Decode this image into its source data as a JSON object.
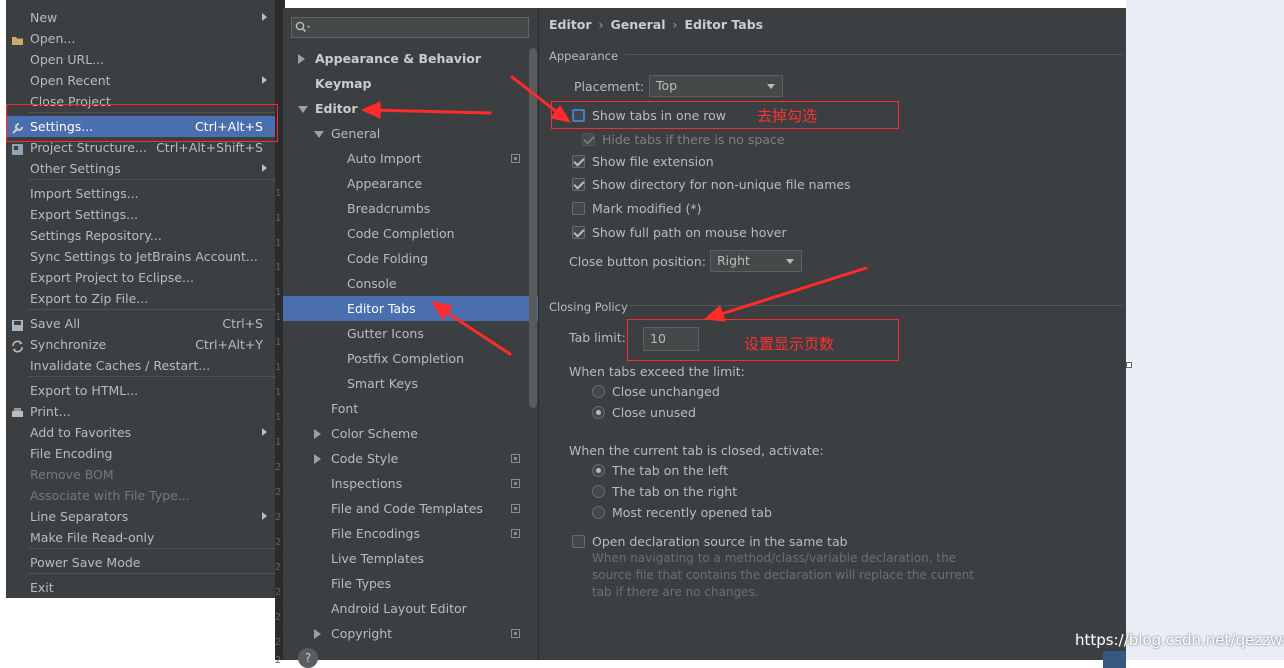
{
  "file_menu": {
    "items": [
      {
        "label": "New",
        "shortcut": "",
        "submenu": true,
        "icon": ""
      },
      {
        "label": "Open...",
        "shortcut": "",
        "submenu": false,
        "icon": "folder-icon"
      },
      {
        "label": "Open URL...",
        "shortcut": "",
        "submenu": false,
        "icon": ""
      },
      {
        "label": "Open Recent",
        "shortcut": "",
        "submenu": true,
        "icon": ""
      },
      {
        "label": "Close Project",
        "shortcut": "",
        "submenu": false,
        "icon": ""
      },
      {
        "label": "Settings...",
        "shortcut": "Ctrl+Alt+S",
        "submenu": false,
        "icon": "wrench-icon",
        "selected": true
      },
      {
        "label": "Project Structure...",
        "shortcut": "Ctrl+Alt+Shift+S",
        "submenu": false,
        "icon": "project-structure-icon"
      },
      {
        "label": "Other Settings",
        "shortcut": "",
        "submenu": true,
        "icon": ""
      },
      {
        "label": "Import Settings...",
        "shortcut": "",
        "submenu": false,
        "icon": ""
      },
      {
        "label": "Export Settings...",
        "shortcut": "",
        "submenu": false,
        "icon": ""
      },
      {
        "label": "Settings Repository...",
        "shortcut": "",
        "submenu": false,
        "icon": ""
      },
      {
        "label": "Sync Settings to JetBrains Account...",
        "shortcut": "",
        "submenu": false,
        "icon": ""
      },
      {
        "label": "Export Project to Eclipse...",
        "shortcut": "",
        "submenu": false,
        "icon": ""
      },
      {
        "label": "Export to Zip File...",
        "shortcut": "",
        "submenu": false,
        "icon": ""
      },
      {
        "label": "Save All",
        "shortcut": "Ctrl+S",
        "submenu": false,
        "icon": "save-icon"
      },
      {
        "label": "Synchronize",
        "shortcut": "Ctrl+Alt+Y",
        "submenu": false,
        "icon": "sync-icon"
      },
      {
        "label": "Invalidate Caches / Restart...",
        "shortcut": "",
        "submenu": false,
        "icon": ""
      },
      {
        "label": "Export to HTML...",
        "shortcut": "",
        "submenu": false,
        "icon": ""
      },
      {
        "label": "Print...",
        "shortcut": "",
        "submenu": false,
        "icon": "print-icon"
      },
      {
        "label": "Add to Favorites",
        "shortcut": "",
        "submenu": true,
        "icon": ""
      },
      {
        "label": "File Encoding",
        "shortcut": "",
        "submenu": false,
        "icon": ""
      },
      {
        "label": "Remove BOM",
        "shortcut": "",
        "submenu": false,
        "icon": "",
        "disabled": true
      },
      {
        "label": "Associate with File Type...",
        "shortcut": "",
        "submenu": false,
        "icon": "",
        "disabled": true
      },
      {
        "label": "Line Separators",
        "shortcut": "",
        "submenu": true,
        "icon": ""
      },
      {
        "label": "Make File Read-only",
        "shortcut": "",
        "submenu": false,
        "icon": ""
      },
      {
        "label": "Power Save Mode",
        "shortcut": "",
        "submenu": false,
        "icon": ""
      },
      {
        "label": "Exit",
        "shortcut": "",
        "submenu": false,
        "icon": ""
      }
    ]
  },
  "gutter_numbers": [
    "1",
    "1",
    "1",
    "1",
    "1",
    "1",
    "1",
    "1",
    "1",
    "1",
    "1",
    "2",
    "2",
    "2",
    "2",
    "2",
    "2",
    "2",
    "2",
    "2"
  ],
  "settings": {
    "search_placeholder": "",
    "tree": [
      {
        "label": "Appearance & Behavior",
        "level": 0,
        "bold": true,
        "expander": "right"
      },
      {
        "label": "Keymap",
        "level": 0,
        "bold": true,
        "expander": ""
      },
      {
        "label": "Editor",
        "level": 0,
        "bold": true,
        "expander": "down"
      },
      {
        "label": "General",
        "level": 1,
        "bold": false,
        "expander": "down"
      },
      {
        "label": "Auto Import",
        "level": 2,
        "bold": false,
        "expander": "",
        "copy_icon": true
      },
      {
        "label": "Appearance",
        "level": 2,
        "bold": false,
        "expander": ""
      },
      {
        "label": "Breadcrumbs",
        "level": 2,
        "bold": false,
        "expander": ""
      },
      {
        "label": "Code Completion",
        "level": 2,
        "bold": false,
        "expander": ""
      },
      {
        "label": "Code Folding",
        "level": 2,
        "bold": false,
        "expander": ""
      },
      {
        "label": "Console",
        "level": 2,
        "bold": false,
        "expander": ""
      },
      {
        "label": "Editor Tabs",
        "level": 2,
        "bold": false,
        "expander": "",
        "selected": true
      },
      {
        "label": "Gutter Icons",
        "level": 2,
        "bold": false,
        "expander": ""
      },
      {
        "label": "Postfix Completion",
        "level": 2,
        "bold": false,
        "expander": ""
      },
      {
        "label": "Smart Keys",
        "level": 2,
        "bold": false,
        "expander": ""
      },
      {
        "label": "Font",
        "level": 1,
        "bold": false,
        "expander": ""
      },
      {
        "label": "Color Scheme",
        "level": 1,
        "bold": false,
        "expander": "right"
      },
      {
        "label": "Code Style",
        "level": 1,
        "bold": false,
        "expander": "right",
        "copy_icon": true
      },
      {
        "label": "Inspections",
        "level": 1,
        "bold": false,
        "expander": "",
        "copy_icon": true
      },
      {
        "label": "File and Code Templates",
        "level": 1,
        "bold": false,
        "expander": "",
        "copy_icon": true
      },
      {
        "label": "File Encodings",
        "level": 1,
        "bold": false,
        "expander": "",
        "copy_icon": true
      },
      {
        "label": "Live Templates",
        "level": 1,
        "bold": false,
        "expander": ""
      },
      {
        "label": "File Types",
        "level": 1,
        "bold": false,
        "expander": ""
      },
      {
        "label": "Android Layout Editor",
        "level": 1,
        "bold": false,
        "expander": ""
      },
      {
        "label": "Copyright",
        "level": 1,
        "bold": false,
        "expander": "right",
        "copy_icon": true
      }
    ],
    "breadcrumb": [
      "Editor",
      "General",
      "Editor Tabs"
    ],
    "appearance": {
      "section": "Appearance",
      "placement_label": "Placement:",
      "placement_value": "Top",
      "show_tabs_one_row": "Show tabs in one row",
      "hide_tabs_no_space": "Hide tabs if there is no space",
      "show_file_extension": "Show file extension",
      "show_directory": "Show directory for non-unique file names",
      "mark_modified": "Mark modified (*)",
      "show_full_path": "Show full path on mouse hover",
      "close_button_label": "Close button position:",
      "close_button_value": "Right"
    },
    "closing": {
      "section": "Closing Policy",
      "tab_limit_label": "Tab limit:",
      "tab_limit_value": "10",
      "exceed_label": "When tabs exceed the limit:",
      "close_unchanged": "Close unchanged",
      "close_unused": "Close unused",
      "closed_label": "When the current tab is closed, activate:",
      "tab_left": "The tab on the left",
      "tab_right": "The tab on the right",
      "most_recent": "Most recently opened tab",
      "open_declaration": "Open declaration source in the same tab",
      "open_declaration_desc": "When navigating to a method/class/variable declaration, the source file that contains the declaration will replace the current tab if there are no changes."
    },
    "help": "?"
  },
  "annotations": {
    "note_uncheck": "去掉勾选",
    "note_set_count": "设置显示页数",
    "color": "#ff2a2a"
  },
  "watermark": "https://blog.csdn.net/qezzwx"
}
